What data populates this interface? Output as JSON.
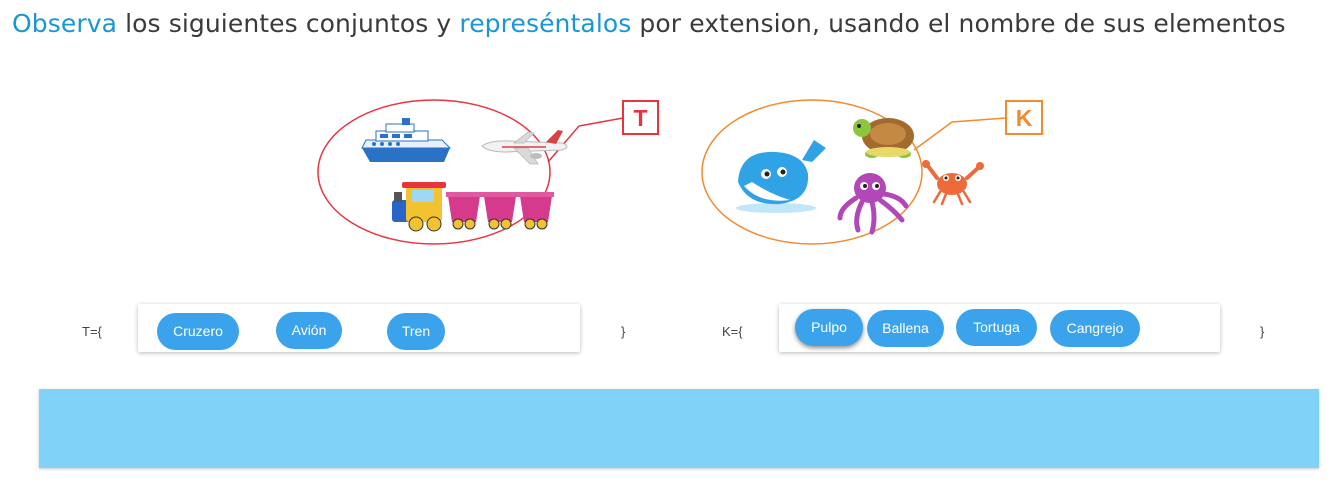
{
  "instruction": {
    "word1": "Observa",
    "text1": " los siguientes conjuntos y ",
    "word2": "represéntalos",
    "text2": " por extension, usando el nombre de sus elementos"
  },
  "sets": [
    {
      "letter": "T",
      "color": "#e8343f",
      "open_label": "T={",
      "close_label": "}",
      "illustrations": [
        "cruise-ship",
        "airplane",
        "toy-train"
      ],
      "chips": [
        "Cruzero",
        "Avión",
        "Tren"
      ]
    },
    {
      "letter": "K",
      "color": "#f28a2e",
      "open_label": "K={",
      "close_label": "}",
      "illustrations": [
        "whale",
        "turtle",
        "octopus",
        "crab"
      ],
      "chips": [
        "Pulpo",
        "Ballena",
        "Tortuga",
        "Cangrejo"
      ]
    }
  ],
  "colors": {
    "accent_text": "#1a96d4",
    "chip": "#3aa3ec",
    "feedback_bar": "#80d2f8"
  }
}
